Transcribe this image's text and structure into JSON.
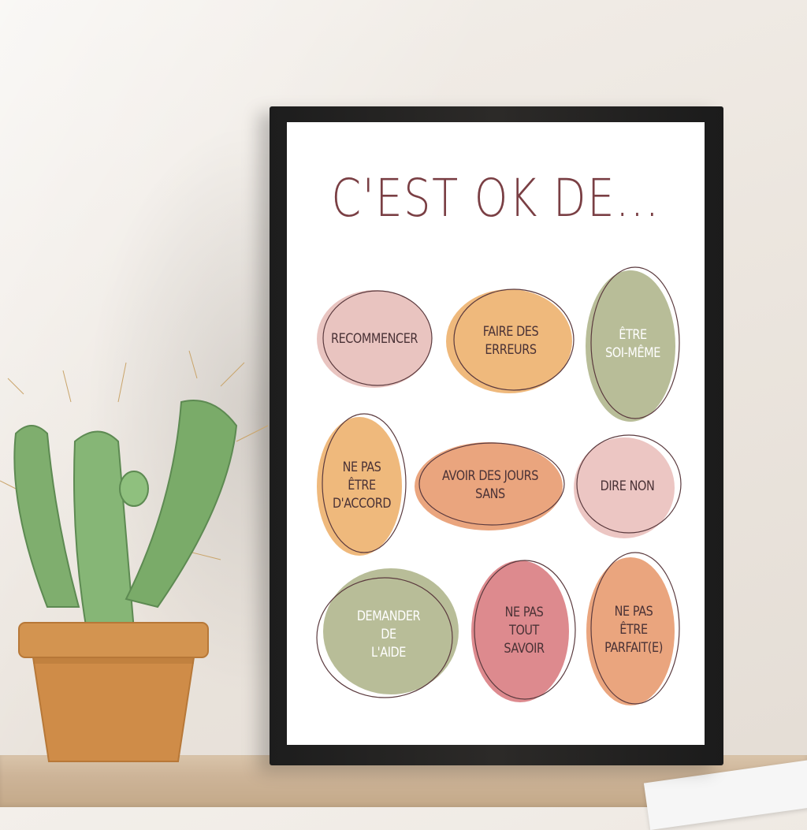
{
  "poster": {
    "title": "C'EST OK DE...",
    "items": [
      {
        "label": "RECOMMENCER",
        "fill": "#e9c4c0"
      },
      {
        "label": "FAIRE DES\nERREURS",
        "fill": "#efb97c"
      },
      {
        "label": "ÊTRE\nSOI-MÊME",
        "fill": "#b8bd98"
      },
      {
        "label": "NE PAS\nÊTRE\nD'ACCORD",
        "fill": "#efb97c"
      },
      {
        "label": "AVOIR DES JOURS\nSANS",
        "fill": "#eaa57e"
      },
      {
        "label": "DIRE NON",
        "fill": "#ecc6c3"
      },
      {
        "label": "DEMANDER\nDE\nL'AIDE",
        "fill": "#b8bd98"
      },
      {
        "label": "NE PAS\nTOUT\nSAVOIR",
        "fill": "#dd8a8e"
      },
      {
        "label": "NE PAS\nÊTRE\nPARFAIT(E)",
        "fill": "#eaa57e"
      }
    ]
  },
  "colors": {
    "title": "#7a3f44",
    "outline": "#5b3a3e",
    "frame": "#232120",
    "cactus": "#7fae6e",
    "pot": "#d08f4c"
  }
}
